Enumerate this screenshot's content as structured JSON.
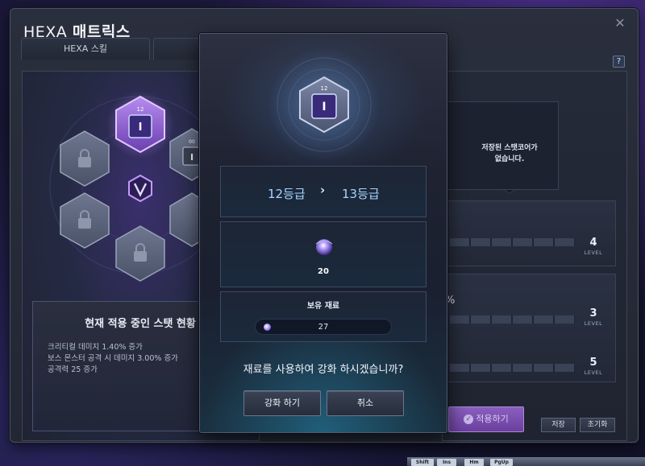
{
  "window": {
    "title_prefix": "HEXA",
    "title_main": "매트릭스",
    "close_label": "✕",
    "help_label": "?"
  },
  "tabs": [
    {
      "label": "HEXA 스킬"
    },
    {
      "label": ""
    }
  ],
  "skill_grid": {
    "selected_node_level": "12",
    "second_node_level": "00"
  },
  "status": {
    "title": "현재 적용 중인 스탯 현황",
    "lines": [
      "크리티컬 데미지 1.40% 증가",
      "보스 몬스터 공격 시 데미지 3.00% 증가",
      "공격력 25 증가"
    ]
  },
  "storage": {
    "line1": "저장된 스탯코어가",
    "line2": "없습니다."
  },
  "stats": {
    "rows": [
      {
        "level": "4"
      },
      {
        "level": "3"
      },
      {
        "level": "5"
      }
    ],
    "level_word": "LEVEL",
    "percent_text": "%"
  },
  "buttons": {
    "apply": "적용하기",
    "save": "저장",
    "reset": "초기화"
  },
  "modal": {
    "icon_level": "12",
    "grade_from": "12등급",
    "grade_arrow": "›",
    "grade_to": "13등급",
    "material_count": "20",
    "own_title": "보유 재료",
    "own_count": "27",
    "confirm_text": "재료를 사용하여 강화 하시겠습니까?",
    "enhance_button": "강화 하기",
    "cancel_button": "취소"
  },
  "taskbar": {
    "keys": [
      "Shift",
      "Ins",
      "Hm",
      "PgUp"
    ]
  },
  "colors": {
    "accent_purple": "#8a5fc0",
    "grade_blue": "#a8d6ff",
    "window_bg": "#2a2f3d"
  }
}
